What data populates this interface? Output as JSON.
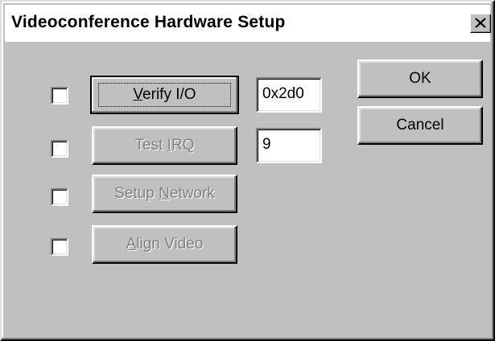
{
  "window": {
    "title": "Videoconference Hardware Setup",
    "close_label": "Close"
  },
  "steps": [
    {
      "checked": false,
      "button_label": "Verify I/O",
      "mnemonic_index": 0,
      "enabled": true,
      "focused": true
    },
    {
      "checked": false,
      "button_label": "Test IRQ",
      "mnemonic_index": 5,
      "enabled": false,
      "focused": false
    },
    {
      "checked": false,
      "button_label": "Setup Network",
      "mnemonic_index": 6,
      "enabled": false,
      "focused": false
    },
    {
      "checked": false,
      "button_label": "Align Video",
      "mnemonic_index": 0,
      "enabled": false,
      "focused": false
    }
  ],
  "fields": {
    "io_address": "0x2d0",
    "irq": "9"
  },
  "actions": {
    "ok_label": "OK",
    "cancel_label": "Cancel"
  },
  "colors": {
    "face": "#c0c0c0",
    "shadow": "#808080",
    "highlight": "#ffffff",
    "disabled_text": "#808080"
  },
  "icons": {
    "close": "close-icon"
  }
}
